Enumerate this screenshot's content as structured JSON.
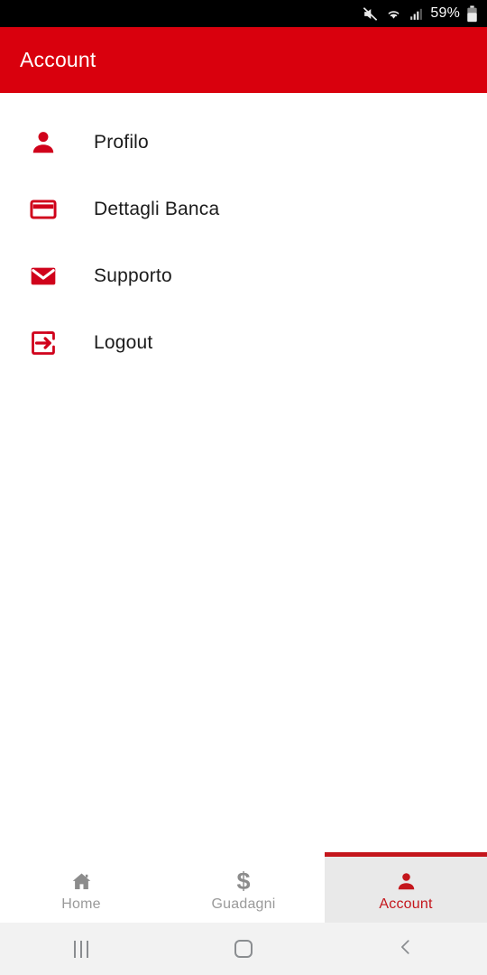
{
  "statusbar": {
    "icons": [
      "mute-icon",
      "wifi-icon",
      "signal-icon"
    ],
    "battery_text": "59%",
    "battery_icon": "battery-icon"
  },
  "appbar": {
    "title": "Account",
    "background_color": "#d9000d",
    "title_color": "#ffffff"
  },
  "menu": {
    "items": [
      {
        "label": "Profilo",
        "icon": "person-icon"
      },
      {
        "label": "Dettagli Banca",
        "icon": "credit-card-icon"
      },
      {
        "label": "Supporto",
        "icon": "envelope-icon"
      },
      {
        "label": "Logout",
        "icon": "logout-icon"
      }
    ],
    "icon_color": "#d0021b",
    "label_color": "#1b1b1b"
  },
  "tabbar": {
    "tabs": [
      {
        "label": "Home",
        "icon": "home-icon",
        "active": false
      },
      {
        "label": "Guadagni",
        "icon": "dollar-icon",
        "active": false
      },
      {
        "label": "Account",
        "icon": "person-icon",
        "active": true
      }
    ],
    "active_color": "#c4161c",
    "inactive_color": "#9a9a9a",
    "active_background": "#e9e9e9"
  },
  "navbar": {
    "buttons": [
      {
        "name": "recents-button",
        "icon": "recents-icon"
      },
      {
        "name": "home-button",
        "icon": "home-square-icon"
      },
      {
        "name": "back-button",
        "icon": "chevron-left-icon"
      }
    ],
    "background_color": "#f2f2f2"
  }
}
